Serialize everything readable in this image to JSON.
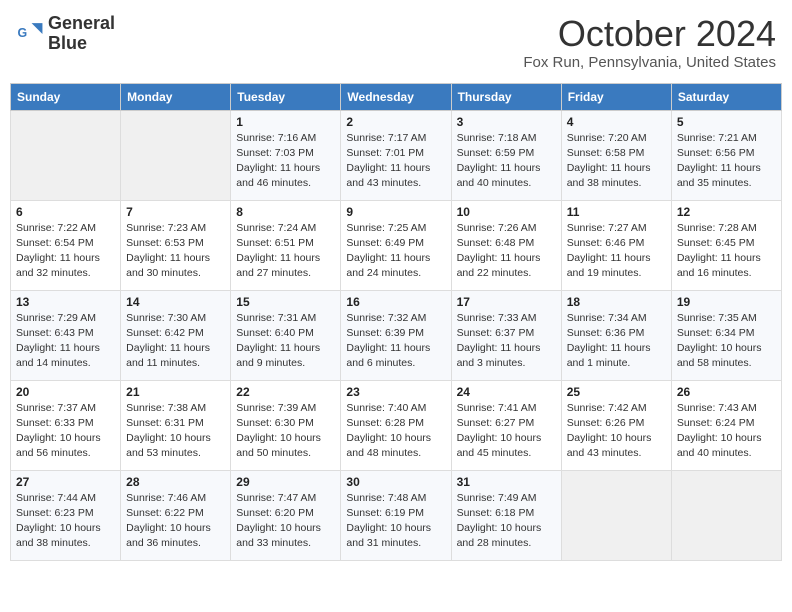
{
  "header": {
    "logo_line1": "General",
    "logo_line2": "Blue",
    "month_title": "October 2024",
    "location": "Fox Run, Pennsylvania, United States"
  },
  "days_of_week": [
    "Sunday",
    "Monday",
    "Tuesday",
    "Wednesday",
    "Thursday",
    "Friday",
    "Saturday"
  ],
  "weeks": [
    [
      {
        "day": "",
        "info": ""
      },
      {
        "day": "",
        "info": ""
      },
      {
        "day": "1",
        "info": "Sunrise: 7:16 AM\nSunset: 7:03 PM\nDaylight: 11 hours and 46 minutes."
      },
      {
        "day": "2",
        "info": "Sunrise: 7:17 AM\nSunset: 7:01 PM\nDaylight: 11 hours and 43 minutes."
      },
      {
        "day": "3",
        "info": "Sunrise: 7:18 AM\nSunset: 6:59 PM\nDaylight: 11 hours and 40 minutes."
      },
      {
        "day": "4",
        "info": "Sunrise: 7:20 AM\nSunset: 6:58 PM\nDaylight: 11 hours and 38 minutes."
      },
      {
        "day": "5",
        "info": "Sunrise: 7:21 AM\nSunset: 6:56 PM\nDaylight: 11 hours and 35 minutes."
      }
    ],
    [
      {
        "day": "6",
        "info": "Sunrise: 7:22 AM\nSunset: 6:54 PM\nDaylight: 11 hours and 32 minutes."
      },
      {
        "day": "7",
        "info": "Sunrise: 7:23 AM\nSunset: 6:53 PM\nDaylight: 11 hours and 30 minutes."
      },
      {
        "day": "8",
        "info": "Sunrise: 7:24 AM\nSunset: 6:51 PM\nDaylight: 11 hours and 27 minutes."
      },
      {
        "day": "9",
        "info": "Sunrise: 7:25 AM\nSunset: 6:49 PM\nDaylight: 11 hours and 24 minutes."
      },
      {
        "day": "10",
        "info": "Sunrise: 7:26 AM\nSunset: 6:48 PM\nDaylight: 11 hours and 22 minutes."
      },
      {
        "day": "11",
        "info": "Sunrise: 7:27 AM\nSunset: 6:46 PM\nDaylight: 11 hours and 19 minutes."
      },
      {
        "day": "12",
        "info": "Sunrise: 7:28 AM\nSunset: 6:45 PM\nDaylight: 11 hours and 16 minutes."
      }
    ],
    [
      {
        "day": "13",
        "info": "Sunrise: 7:29 AM\nSunset: 6:43 PM\nDaylight: 11 hours and 14 minutes."
      },
      {
        "day": "14",
        "info": "Sunrise: 7:30 AM\nSunset: 6:42 PM\nDaylight: 11 hours and 11 minutes."
      },
      {
        "day": "15",
        "info": "Sunrise: 7:31 AM\nSunset: 6:40 PM\nDaylight: 11 hours and 9 minutes."
      },
      {
        "day": "16",
        "info": "Sunrise: 7:32 AM\nSunset: 6:39 PM\nDaylight: 11 hours and 6 minutes."
      },
      {
        "day": "17",
        "info": "Sunrise: 7:33 AM\nSunset: 6:37 PM\nDaylight: 11 hours and 3 minutes."
      },
      {
        "day": "18",
        "info": "Sunrise: 7:34 AM\nSunset: 6:36 PM\nDaylight: 11 hours and 1 minute."
      },
      {
        "day": "19",
        "info": "Sunrise: 7:35 AM\nSunset: 6:34 PM\nDaylight: 10 hours and 58 minutes."
      }
    ],
    [
      {
        "day": "20",
        "info": "Sunrise: 7:37 AM\nSunset: 6:33 PM\nDaylight: 10 hours and 56 minutes."
      },
      {
        "day": "21",
        "info": "Sunrise: 7:38 AM\nSunset: 6:31 PM\nDaylight: 10 hours and 53 minutes."
      },
      {
        "day": "22",
        "info": "Sunrise: 7:39 AM\nSunset: 6:30 PM\nDaylight: 10 hours and 50 minutes."
      },
      {
        "day": "23",
        "info": "Sunrise: 7:40 AM\nSunset: 6:28 PM\nDaylight: 10 hours and 48 minutes."
      },
      {
        "day": "24",
        "info": "Sunrise: 7:41 AM\nSunset: 6:27 PM\nDaylight: 10 hours and 45 minutes."
      },
      {
        "day": "25",
        "info": "Sunrise: 7:42 AM\nSunset: 6:26 PM\nDaylight: 10 hours and 43 minutes."
      },
      {
        "day": "26",
        "info": "Sunrise: 7:43 AM\nSunset: 6:24 PM\nDaylight: 10 hours and 40 minutes."
      }
    ],
    [
      {
        "day": "27",
        "info": "Sunrise: 7:44 AM\nSunset: 6:23 PM\nDaylight: 10 hours and 38 minutes."
      },
      {
        "day": "28",
        "info": "Sunrise: 7:46 AM\nSunset: 6:22 PM\nDaylight: 10 hours and 36 minutes."
      },
      {
        "day": "29",
        "info": "Sunrise: 7:47 AM\nSunset: 6:20 PM\nDaylight: 10 hours and 33 minutes."
      },
      {
        "day": "30",
        "info": "Sunrise: 7:48 AM\nSunset: 6:19 PM\nDaylight: 10 hours and 31 minutes."
      },
      {
        "day": "31",
        "info": "Sunrise: 7:49 AM\nSunset: 6:18 PM\nDaylight: 10 hours and 28 minutes."
      },
      {
        "day": "",
        "info": ""
      },
      {
        "day": "",
        "info": ""
      }
    ]
  ]
}
